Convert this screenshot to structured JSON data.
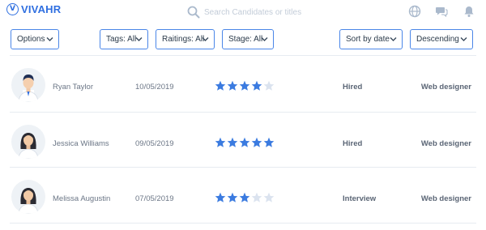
{
  "header": {
    "logo_text": "VIVAHR",
    "search_placeholder": "Search Candidates or titles",
    "icons": [
      "search-icon",
      "globe-icon",
      "chat-icon",
      "bell-icon"
    ]
  },
  "filters": {
    "options_label": "Options",
    "tags_label": "Tags: All",
    "ratings_label": "Raitings: All",
    "stage_label": "Stage: All",
    "sort_label": "Sort by date",
    "order_label": "Descending"
  },
  "colors": {
    "accent": "#4a86e8",
    "brand": "#2f6fe0",
    "star_filled": "#3b7be0",
    "star_empty": "#dbe3ef"
  },
  "candidates": [
    {
      "name": "Ryan Taylor",
      "date": "10/05/2019",
      "rating": 4,
      "max_rating": 5,
      "stage": "Hired",
      "role": "Web designer",
      "avatar": "male-avatar"
    },
    {
      "name": "Jessica Williams",
      "date": "09/05/2019",
      "rating": 5,
      "max_rating": 5,
      "stage": "Hired",
      "role": "Web designer",
      "avatar": "female-avatar"
    },
    {
      "name": "Melissa Augustin",
      "date": "07/05/2019",
      "rating": 3,
      "max_rating": 5,
      "stage": "Interview",
      "role": "Web designer",
      "avatar": "female-avatar"
    }
  ]
}
